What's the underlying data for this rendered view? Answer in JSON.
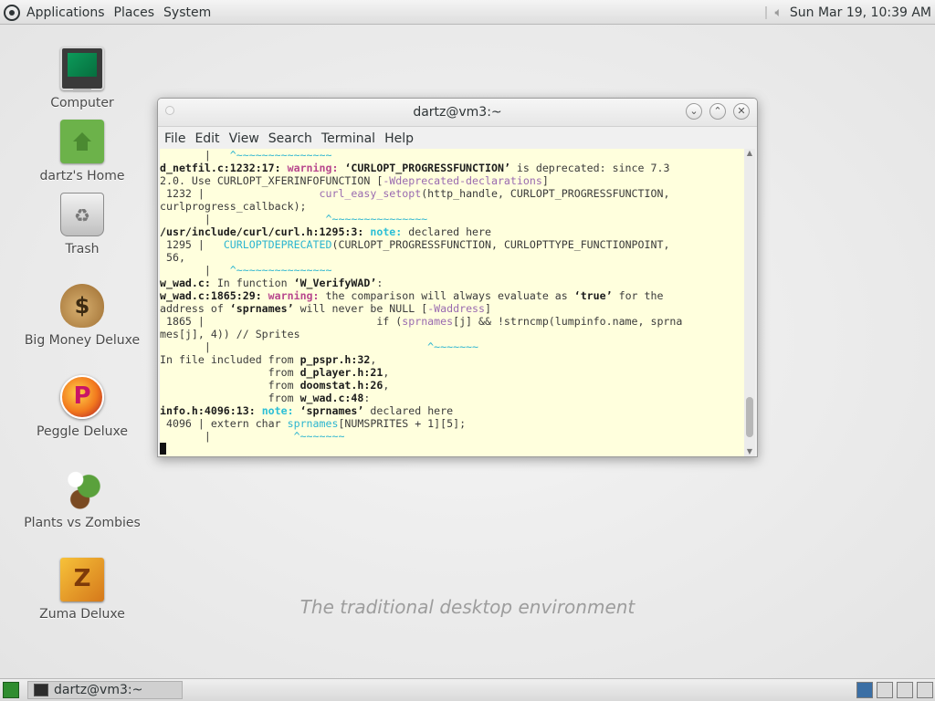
{
  "top_panel": {
    "menus": [
      "Applications",
      "Places",
      "System"
    ],
    "clock": "Sun Mar 19, 10:39 AM"
  },
  "desktop": {
    "tagline": "The traditional desktop environment",
    "icons": [
      {
        "label": "Computer",
        "icon": "computer-icon"
      },
      {
        "label": "dartz's Home",
        "icon": "home-folder-icon"
      },
      {
        "label": "Trash",
        "icon": "trash-icon"
      },
      {
        "label": "Big Money Deluxe",
        "icon": "money-bag-icon"
      },
      {
        "label": "Peggle Deluxe",
        "icon": "peggle-icon"
      },
      {
        "label": "Plants vs Zombies",
        "icon": "plants-vs-zombies-icon"
      },
      {
        "label": "Zuma Deluxe",
        "icon": "zuma-icon"
      }
    ]
  },
  "terminal": {
    "title": "dartz@vm3:~",
    "menu": [
      "File",
      "Edit",
      "View",
      "Search",
      "Terminal",
      "Help"
    ],
    "lines": [
      [
        {
          "t": "       |   "
        },
        {
          "t": "^~~~~~~~~~~~~~~~",
          "s": "c"
        }
      ],
      [
        {
          "t": "d_netfil.c:1232:17:",
          "s": "b"
        },
        {
          "t": " "
        },
        {
          "t": "warning:",
          "s": "w"
        },
        {
          "t": " "
        },
        {
          "t": "‘CURLOPT_PROGRESSFUNCTION’",
          "s": "b"
        },
        {
          "t": " is deprecated: since 7.3"
        }
      ],
      [
        {
          "t": "2.0. Use CURLOPT_XFERINFOFUNCTION ["
        },
        {
          "t": "-Wdeprecated-declarations",
          "s": "p"
        },
        {
          "t": "]"
        }
      ],
      [
        {
          "t": " 1232 |                  "
        },
        {
          "t": "curl_easy_setopt",
          "s": "p"
        },
        {
          "t": "(http_handle, CURLOPT_PROGRESSFUNCTION,"
        }
      ],
      [
        {
          "t": "curlprogress_callback);"
        }
      ],
      [
        {
          "t": "       |                  "
        },
        {
          "t": "^~~~~~~~~~~~~~~~",
          "s": "c"
        }
      ],
      [
        {
          "t": "/usr/include/curl/curl.h:1295:3:",
          "s": "b"
        },
        {
          "t": " "
        },
        {
          "t": "note:",
          "s": "n"
        },
        {
          "t": " declared here"
        }
      ],
      [
        {
          "t": " 1295 |   "
        },
        {
          "t": "CURLOPTDEPRECATED",
          "s": "c"
        },
        {
          "t": "(CURLOPT_PROGRESSFUNCTION, CURLOPTTYPE_FUNCTIONPOINT,"
        }
      ],
      [
        {
          "t": " 56,"
        }
      ],
      [
        {
          "t": "       |   "
        },
        {
          "t": "^~~~~~~~~~~~~~~~",
          "s": "c"
        }
      ],
      [
        {
          "t": "w_wad.c:",
          "s": "b"
        },
        {
          "t": " In function "
        },
        {
          "t": "‘W_VerifyWAD’",
          "s": "b"
        },
        {
          "t": ":"
        }
      ],
      [
        {
          "t": "w_wad.c:1865:29:",
          "s": "b"
        },
        {
          "t": " "
        },
        {
          "t": "warning:",
          "s": "w"
        },
        {
          "t": " the comparison will always evaluate as "
        },
        {
          "t": "‘true’",
          "s": "b"
        },
        {
          "t": " for the"
        }
      ],
      [
        {
          "t": "address of "
        },
        {
          "t": "‘sprnames’",
          "s": "b"
        },
        {
          "t": " will never be NULL ["
        },
        {
          "t": "-Waddress",
          "s": "p"
        },
        {
          "t": "]"
        }
      ],
      [
        {
          "t": " 1865 |                           if ("
        },
        {
          "t": "sprnames",
          "s": "p"
        },
        {
          "t": "[j] && !strncmp(lumpinfo.name, sprna"
        }
      ],
      [
        {
          "t": "mes[j], 4)) // Sprites"
        }
      ],
      [
        {
          "t": "       |                                  "
        },
        {
          "t": "^~~~~~~~",
          "s": "c"
        }
      ],
      [
        {
          "t": "In file included from "
        },
        {
          "t": "p_pspr.h:32",
          "s": "b"
        },
        {
          "t": ","
        }
      ],
      [
        {
          "t": "                 from "
        },
        {
          "t": "d_player.h:21",
          "s": "b"
        },
        {
          "t": ","
        }
      ],
      [
        {
          "t": "                 from "
        },
        {
          "t": "doomstat.h:26",
          "s": "b"
        },
        {
          "t": ","
        }
      ],
      [
        {
          "t": "                 from "
        },
        {
          "t": "w_wad.c:48",
          "s": "b"
        },
        {
          "t": ":"
        }
      ],
      [
        {
          "t": "info.h:4096:13:",
          "s": "b"
        },
        {
          "t": " "
        },
        {
          "t": "note:",
          "s": "n"
        },
        {
          "t": " "
        },
        {
          "t": "‘sprnames’",
          "s": "b"
        },
        {
          "t": " declared here"
        }
      ],
      [
        {
          "t": " 4096 | extern char "
        },
        {
          "t": "sprnames",
          "s": "c"
        },
        {
          "t": "[NUMSPRITES + 1][5];"
        }
      ],
      [
        {
          "t": "       |             "
        },
        {
          "t": "^~~~~~~~",
          "s": "c"
        }
      ]
    ]
  },
  "bottom_panel": {
    "task_label": "dartz@vm3:~"
  }
}
